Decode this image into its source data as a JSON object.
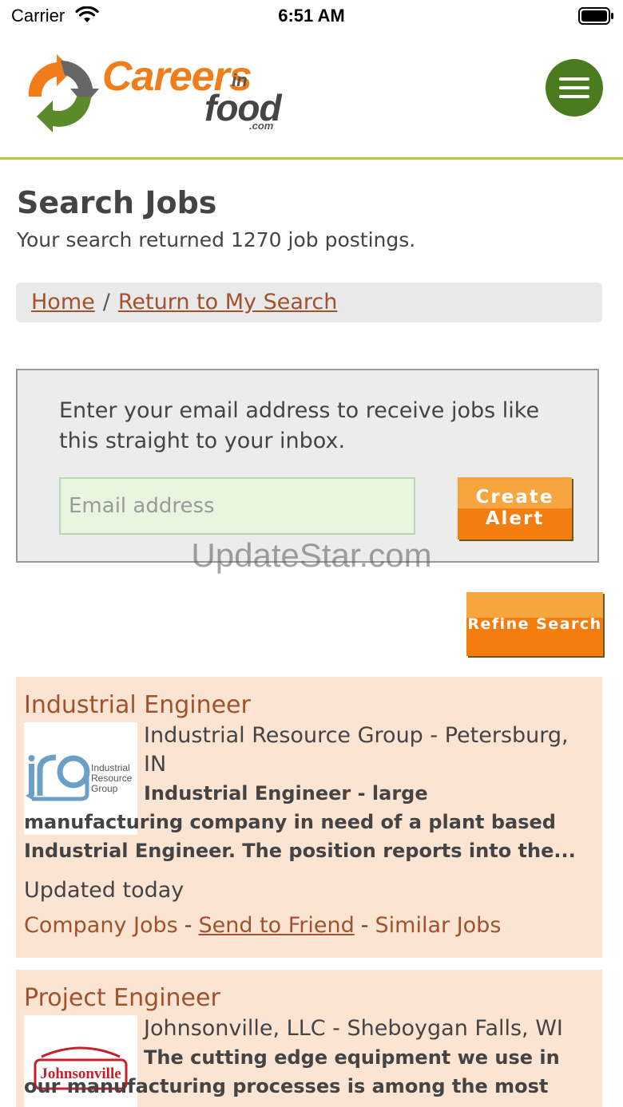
{
  "status_bar": {
    "carrier": "Carrier",
    "time": "6:51 AM"
  },
  "header": {
    "logo": {
      "careers": "Careers",
      "in": "in",
      "food": "food",
      "com": ".com"
    },
    "menu_icon": "hamburger-menu-icon"
  },
  "page": {
    "title": "Search Jobs",
    "result_summary": "Your search returned 1270 job postings."
  },
  "breadcrumb": {
    "home": "Home",
    "separator": "/",
    "return": "Return to My Search"
  },
  "alert": {
    "text": "Enter your email address to receive jobs like this straight to your inbox.",
    "email_placeholder": "Email address",
    "email_value": "",
    "button_line1": "Create",
    "button_line2": "Alert"
  },
  "watermark": "UpdateStar.com",
  "refine_label": "Refine Search",
  "jobs": [
    {
      "title": "Industrial Engineer",
      "company_location": "Industrial Resource Group - Petersburg, IN",
      "logo_text": [
        "Industrial",
        "Resource",
        "Group"
      ],
      "description": "Industrial Engineer - large manufacturing company in need of a plant based Industrial Engineer. The position reports into the...",
      "updated": "Updated today",
      "links": {
        "company_jobs": "Company Jobs",
        "sep": "-",
        "send_to_friend": "Send to Friend",
        "similar_jobs": "Similar Jobs"
      }
    },
    {
      "title": "Project Engineer",
      "company_location": "Johnsonville, LLC - Sheboygan Falls, WI",
      "logo_text": [
        "Johnsonville"
      ],
      "description": "The cutting edge equipment we use in our manufacturing processes is among the most"
    }
  ],
  "colors": {
    "accent_green": "#4a7c1f",
    "divider_green": "#b5cd3a",
    "orange": "#f47d10",
    "link_brown": "#a0522d",
    "card_bg": "#fce4d3"
  }
}
